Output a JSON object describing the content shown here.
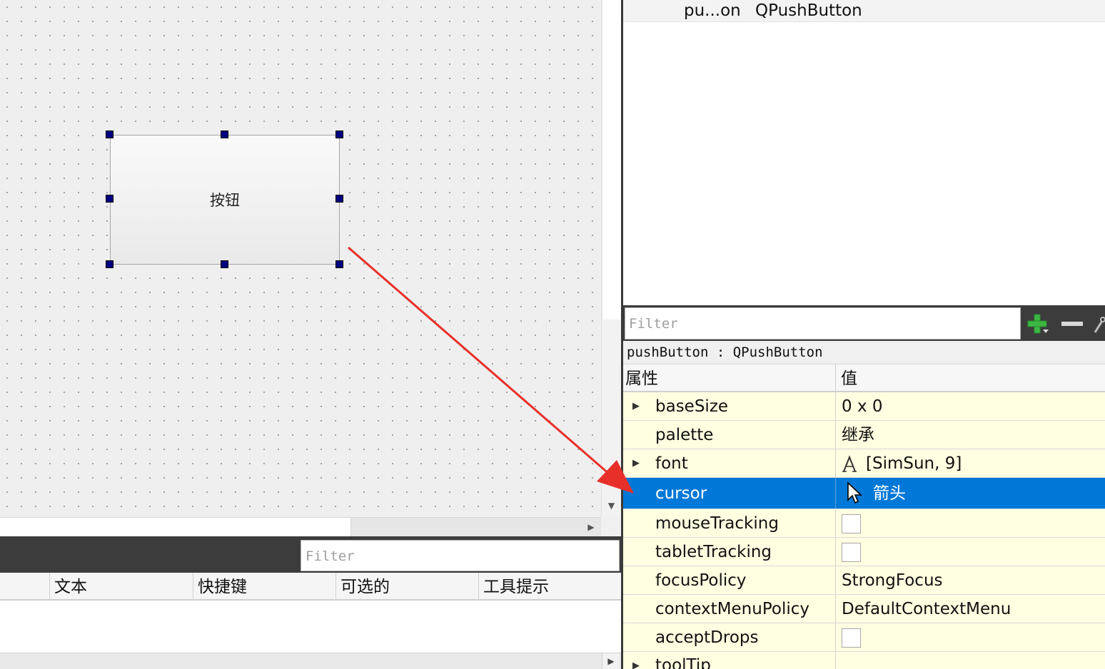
{
  "canvas": {
    "button_text": "按钮"
  },
  "action_editor": {
    "filter_placeholder": "Filter",
    "columns": [
      "文本",
      "快捷键",
      "可选的",
      "工具提示"
    ]
  },
  "object_inspector": {
    "row": {
      "name": "pu...on",
      "class": "QPushButton"
    }
  },
  "property_editor": {
    "filter_placeholder": "Filter",
    "object_label": "pushButton : QPushButton",
    "header_property": "属性",
    "header_value": "值",
    "rows": [
      {
        "name": "baseSize",
        "value": "0 x 0",
        "expandable": true
      },
      {
        "name": "palette",
        "value": "继承",
        "expandable": false
      },
      {
        "name": "font",
        "value": "[SimSun, 9]",
        "expandable": true,
        "icon": "font-icon"
      },
      {
        "name": "cursor",
        "value": "箭头",
        "expandable": false,
        "icon": "arrow-cursor-icon",
        "selected": true
      },
      {
        "name": "mouseTracking",
        "value": "",
        "checkbox": true,
        "checked": false
      },
      {
        "name": "tabletTracking",
        "value": "",
        "checkbox": true,
        "checked": false
      },
      {
        "name": "focusPolicy",
        "value": "StrongFocus"
      },
      {
        "name": "contextMenuPolicy",
        "value": "DefaultContextMenu"
      },
      {
        "name": "acceptDrops",
        "value": "",
        "checkbox": true,
        "checked": false
      },
      {
        "name": "toolTip",
        "value": "",
        "expandable": true
      }
    ]
  },
  "colors": {
    "selection": "#0078d7",
    "property_row_bg": "#ffffe1",
    "handle": "#000080",
    "annotation_arrow": "#e8302a",
    "plus_icon": "#3cb843"
  },
  "icons": [
    "plus-icon",
    "minus-icon",
    "wrench-icon",
    "expand-arrow-icon",
    "font-icon",
    "arrow-cursor-icon",
    "scroll-down-icon",
    "scroll-right-icon"
  ]
}
